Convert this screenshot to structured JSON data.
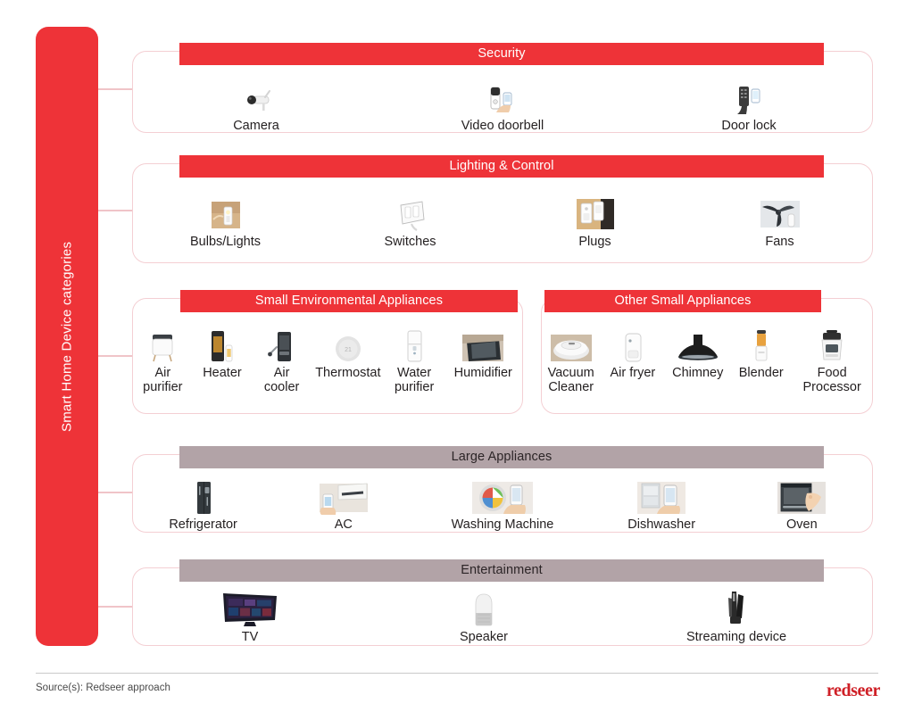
{
  "colors": {
    "brand_red": "#ee3338",
    "header_mauve": "#b2a3a7",
    "panel_border": "#f4cfd3",
    "connector": "#f0c4c8",
    "logo_red": "#cf2027"
  },
  "spine": {
    "label": "Smart Home Device categories"
  },
  "footer": {
    "source": "Source(s): Redseer approach",
    "logo": "redseer"
  },
  "rows": [
    {
      "id": "security",
      "panels": [
        {
          "id": "security",
          "header": "Security",
          "header_style": "red",
          "items": [
            {
              "label": "Camera",
              "icon": "security-camera-icon"
            },
            {
              "label": "Video doorbell",
              "icon": "video-doorbell-icon"
            },
            {
              "label": "Door lock",
              "icon": "door-lock-icon"
            }
          ]
        }
      ]
    },
    {
      "id": "lighting-control",
      "panels": [
        {
          "id": "lighting-control",
          "header": "Lighting & Control",
          "header_style": "red",
          "items": [
            {
              "label": "Bulbs/Lights",
              "icon": "bulb-icon"
            },
            {
              "label": "Switches",
              "icon": "switch-icon"
            },
            {
              "label": "Plugs",
              "icon": "plug-icon"
            },
            {
              "label": "Fans",
              "icon": "fan-icon"
            }
          ]
        }
      ]
    },
    {
      "id": "small-appliances",
      "panels": [
        {
          "id": "small-environmental-appliances",
          "header": "Small Environmental Appliances",
          "header_style": "red",
          "items": [
            {
              "label": "Air\npurifier",
              "icon": "air-purifier-icon"
            },
            {
              "label": "Heater",
              "icon": "heater-icon"
            },
            {
              "label": "Air\ncooler",
              "icon": "air-cooler-icon"
            },
            {
              "label": "Thermostat",
              "icon": "thermostat-icon"
            },
            {
              "label": "Water\npurifier",
              "icon": "water-purifier-icon"
            },
            {
              "label": "Humidifier",
              "icon": "humidifier-icon"
            }
          ]
        },
        {
          "id": "other-small-appliances",
          "header": "Other Small Appliances",
          "header_style": "red",
          "items": [
            {
              "label": "Vacuum\nCleaner",
              "icon": "vacuum-cleaner-icon"
            },
            {
              "label": "Air fryer",
              "icon": "air-fryer-icon"
            },
            {
              "label": "Chimney",
              "icon": "chimney-icon"
            },
            {
              "label": "Blender",
              "icon": "blender-icon"
            },
            {
              "label": "Food\nProcessor",
              "icon": "food-processor-icon"
            }
          ]
        }
      ]
    },
    {
      "id": "large-appliances",
      "panels": [
        {
          "id": "large-appliances",
          "header": "Large Appliances",
          "header_style": "mauve",
          "items": [
            {
              "label": "Refrigerator",
              "icon": "refrigerator-icon"
            },
            {
              "label": "AC",
              "icon": "air-conditioner-icon"
            },
            {
              "label": "Washing Machine",
              "icon": "washing-machine-icon"
            },
            {
              "label": "Dishwasher",
              "icon": "dishwasher-icon"
            },
            {
              "label": "Oven",
              "icon": "oven-icon"
            }
          ]
        }
      ]
    },
    {
      "id": "entertainment",
      "panels": [
        {
          "id": "entertainment",
          "header": "Entertainment",
          "header_style": "mauve",
          "items": [
            {
              "label": "TV",
              "icon": "tv-icon"
            },
            {
              "label": "Speaker",
              "icon": "smart-speaker-icon"
            },
            {
              "label": "Streaming device",
              "icon": "streaming-device-icon"
            }
          ]
        }
      ]
    }
  ]
}
